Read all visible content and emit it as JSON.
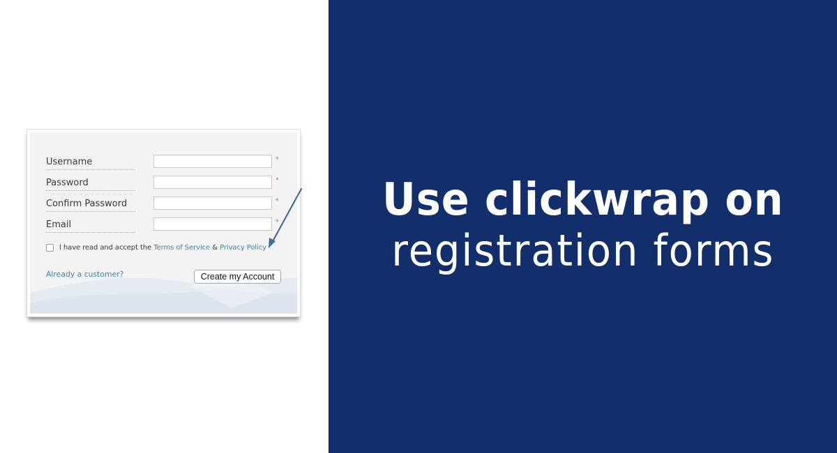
{
  "headline": {
    "line1": "Use clickwrap on",
    "line2": "registration forms"
  },
  "colors": {
    "panel_background": "#122e6b",
    "link": "#3f87a7",
    "arrow": "#3f6f9a",
    "required_marker": "#d05a5a"
  },
  "form": {
    "fields": [
      {
        "label": "Username",
        "value": "",
        "required_marker": "*"
      },
      {
        "label": "Password",
        "value": "",
        "required_marker": "*"
      },
      {
        "label": "Confirm Password",
        "value": "",
        "required_marker": "*"
      },
      {
        "label": "Email",
        "value": "",
        "required_marker": "*"
      }
    ],
    "terms": {
      "checked": false,
      "prefix": "I have read and accept the",
      "terms_link": "Terms of Service",
      "separator": "&",
      "privacy_link": "Privacy Policy"
    },
    "already_customer_link": "Already a customer?",
    "submit_label": "Create my Account"
  },
  "annotation": {
    "arrow_icon": "arrow-pointing-to-privacy-policy"
  }
}
